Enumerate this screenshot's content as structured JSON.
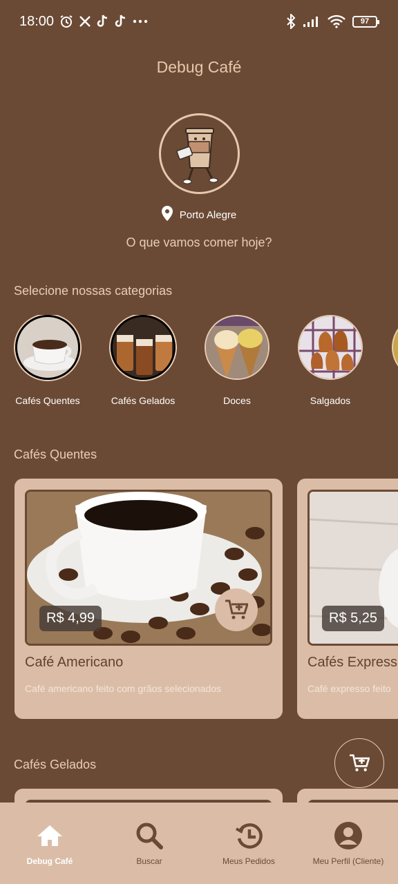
{
  "status_bar": {
    "time": "18:00",
    "battery": "97"
  },
  "header": {
    "title": "Debug Café",
    "location": "Porto Alegre",
    "tagline": "O que vamos comer hoje?"
  },
  "categories": {
    "title": "Selecione nossas categorias",
    "items": [
      {
        "label": "Cafés Quentes"
      },
      {
        "label": "Cafés Gelados"
      },
      {
        "label": "Doces"
      },
      {
        "label": "Salgados"
      }
    ]
  },
  "sections": {
    "hot": {
      "title": "Cafés Quentes",
      "products": [
        {
          "name": "Café Americano",
          "description": "Café americano feito com grãos selecionados",
          "price": "R$ 4,99"
        },
        {
          "name": "Cafés Express",
          "description": "Café expresso feito",
          "price": "R$ 5,25"
        }
      ]
    },
    "cold": {
      "title": "Cafés Gelados"
    }
  },
  "nav": {
    "items": [
      {
        "label": "Debug Café",
        "icon": "home-icon"
      },
      {
        "label": "Buscar",
        "icon": "search-icon"
      },
      {
        "label": "Meus Pedidos",
        "icon": "history-icon"
      },
      {
        "label": "Meu Perfil (Cliente)",
        "icon": "profile-icon"
      }
    ]
  },
  "colors": {
    "background": "#6b4a35",
    "card": "#dbbda7",
    "accent": "#e8cdb5",
    "text_dark": "#5f4232"
  }
}
